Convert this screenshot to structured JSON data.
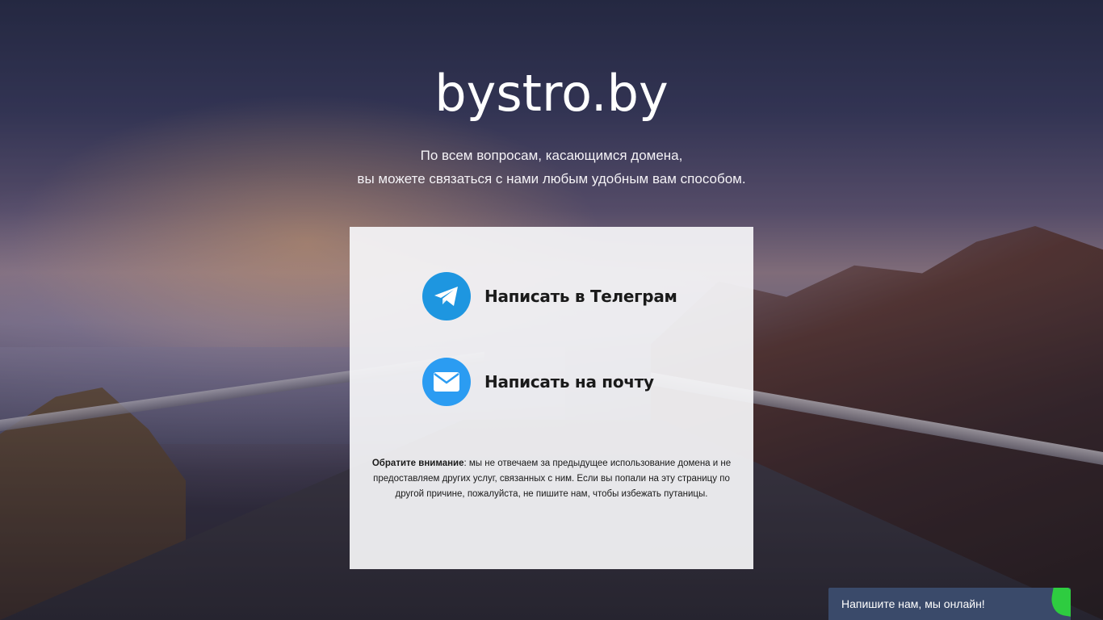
{
  "header": {
    "site_title": "bystro.by",
    "subtitle_line1": "По всем вопросам, касающимся домена,",
    "subtitle_line2": "вы можете связаться с нами любым удобным вам способом."
  },
  "contacts": {
    "telegram": {
      "label": "Написать в Телеграм",
      "icon": "telegram-icon",
      "color": "#1e96e0"
    },
    "email": {
      "label": "Написать на почту",
      "icon": "envelope-icon",
      "color": "#2b9cf2"
    }
  },
  "notice": {
    "bold": "Обратите внимание",
    "text": ": мы не отвечаем за предыдущее использование домена и не предоставляем других услуг, связанных с ним. Если вы попали на эту страницу по другой причине, пожалуйста, не пишите нам, чтобы избежать путаницы."
  },
  "chat_widget": {
    "label": "Напишите нам, мы онлайн!",
    "background_color": "#3a4a6a",
    "accent_color": "#2ecc40"
  }
}
